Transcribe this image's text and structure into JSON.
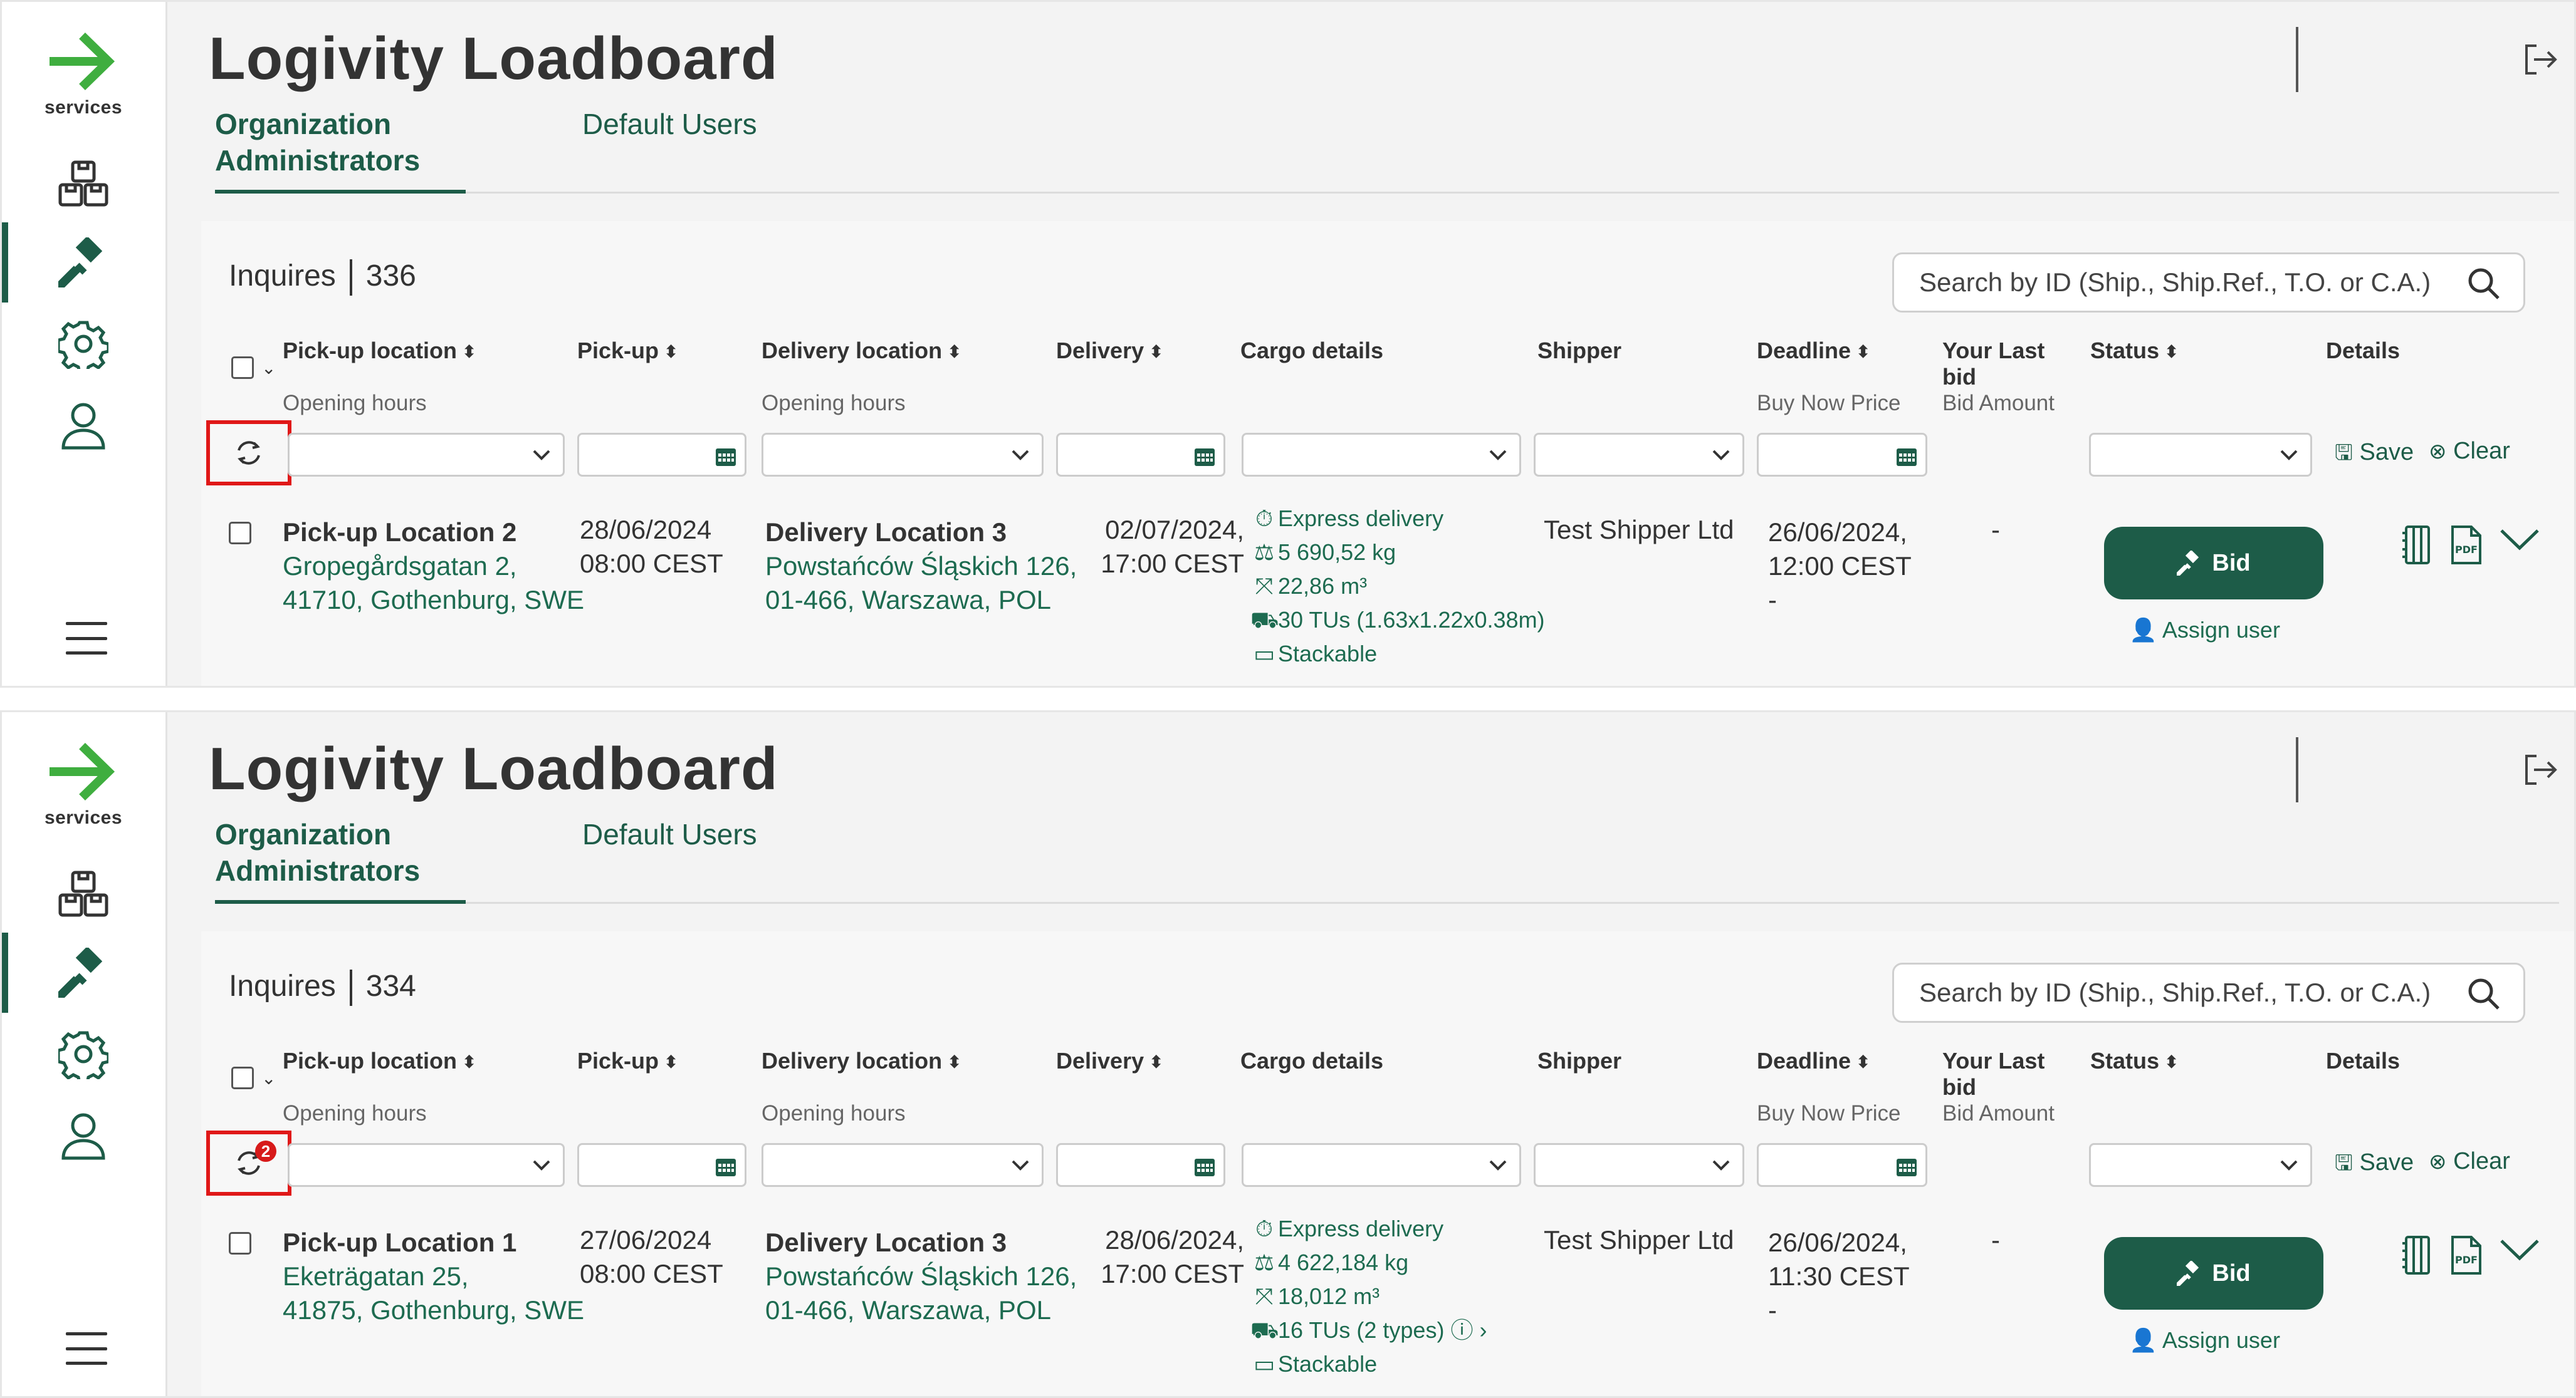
{
  "sidebar": {
    "logo_text": "services",
    "icons": [
      "boxes-icon",
      "gavel-icon",
      "gear-icon",
      "user-icon",
      "menu-icon"
    ],
    "accent_color": "#1d5c48",
    "logo_color": "#3fae3f"
  },
  "header": {
    "title": "Logivity Loadboard",
    "tabs": [
      {
        "label": "Organization Administrators",
        "active": true
      },
      {
        "label": "Default Users",
        "active": false
      }
    ]
  },
  "columns": {
    "pickup_location": "Pick-up location",
    "pickup": "Pick-up",
    "delivery_location": "Delivery location",
    "delivery": "Delivery",
    "cargo": "Cargo details",
    "shipper": "Shipper",
    "deadline": "Deadline",
    "your_last_bid": "Your Last bid",
    "status": "Status",
    "details": "Details",
    "opening_hours_1": "Opening hours",
    "opening_hours_2": "Opening hours",
    "buy_now_price": "Buy Now Price",
    "bid_amount": "Bid Amount"
  },
  "search": {
    "placeholder": "Search by ID (Ship., Ship.Ref., T.O. or C.A.)"
  },
  "filters": {
    "save": "Save",
    "clear": "Clear"
  },
  "panels": [
    {
      "inquiries_label": "Inquires",
      "inquiries_count": "336",
      "refresh_badge": "",
      "row": {
        "pickup_name": "Pick-up Location 2",
        "pickup_addr1": "Gropegårdsgatan 2,",
        "pickup_addr2": "41710, Gothenburg, SWE",
        "pickup_date": "28/06/2024",
        "pickup_time": "08:00 CEST",
        "delivery_name": "Delivery Location 3",
        "delivery_addr1": "Powstańców Śląskich 126,",
        "delivery_addr2": "01-466, Warszawa, POL",
        "delivery_date": "02/07/2024,",
        "delivery_time": "17:00 CEST",
        "cargo": [
          "Express delivery",
          "5 690,52 kg",
          "22,86 m³",
          "30 TUs (1.63x1.22x0.38m)",
          "Stackable"
        ],
        "shipper": "Test Shipper Ltd",
        "deadline_date": "26/06/2024,",
        "deadline_time": "12:00 CEST",
        "deadline_extra": "-",
        "last_bid": "-",
        "bid_label": "Bid",
        "assign_label": "Assign user"
      }
    },
    {
      "inquiries_label": "Inquires",
      "inquiries_count": "334",
      "refresh_badge": "2",
      "row": {
        "pickup_name": "Pick-up Location 1",
        "pickup_addr1": "Eketrägatan 25,",
        "pickup_addr2": "41875, Gothenburg, SWE",
        "pickup_date": "27/06/2024",
        "pickup_time": "08:00 CEST",
        "delivery_name": "Delivery Location 3",
        "delivery_addr1": "Powstańców Śląskich 126,",
        "delivery_addr2": "01-466, Warszawa, POL",
        "delivery_date": "28/06/2024,",
        "delivery_time": "17:00 CEST",
        "cargo": [
          "Express delivery",
          "4 622,184 kg",
          "18,012 m³",
          "16 TUs (2 types)",
          "Stackable"
        ],
        "shipper": "Test Shipper Ltd",
        "deadline_date": "26/06/2024,",
        "deadline_time": "11:30 CEST",
        "deadline_extra": "-",
        "last_bid": "-",
        "bid_label": "Bid",
        "assign_label": "Assign user"
      }
    }
  ]
}
